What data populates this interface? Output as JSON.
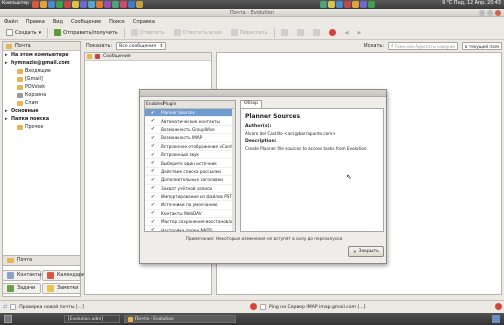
{
  "top_panel": {
    "launcher": "Компьютер",
    "clock": "9 °C   Пнд, 12 Апр, 20:43"
  },
  "window": {
    "title": "Почта - Evolution"
  },
  "menubar": [
    "Файл",
    "Правка",
    "Вид",
    "Сообщение",
    "Поиск",
    "Справка"
  ],
  "toolbar": {
    "new_label": "Создать",
    "send_receive_label": "Отправить/получить",
    "reply_label": "Ответить",
    "reply_all_label": "Ответить всем",
    "forward_label": "Переслать"
  },
  "sidebar": {
    "header": "Почта",
    "items": [
      {
        "label": "На этом компьютере",
        "indent": 0,
        "bold": true
      },
      {
        "label": "hymnazio@gmail.com",
        "indent": 0,
        "bold": true
      },
      {
        "label": "Входящие",
        "indent": 1,
        "bold": false
      },
      {
        "label": "[Gmail]",
        "indent": 1,
        "bold": false
      },
      {
        "label": "POVstek",
        "indent": 1,
        "bold": false
      },
      {
        "label": "Корзина",
        "indent": 1,
        "bold": false
      },
      {
        "label": "Спам",
        "indent": 1,
        "bold": false
      },
      {
        "label": "Основные",
        "indent": 0,
        "bold": true
      },
      {
        "label": "Папки поиска",
        "indent": 0,
        "bold": true
      },
      {
        "label": "Прочее",
        "indent": 1,
        "bold": false
      }
    ],
    "switcher": {
      "mail": "Почта",
      "contacts": "Контакты",
      "calendar": "Календари",
      "tasks": "Задачи",
      "memos": "Заметки"
    }
  },
  "filterbar": {
    "show_label": "Показать:",
    "show_value": "Все сообщения",
    "search_label": "Искать:",
    "search_placeholder": "Тема или Адресаты содержат",
    "scope_value": "в текущей папке"
  },
  "message_list": {
    "column_header": "Сообщения"
  },
  "dialog": {
    "columns": {
      "enabled": "Enabled",
      "plugin": "Plugin"
    },
    "tab": "Обзор",
    "plugins": [
      {
        "name": "Planner Sources",
        "selected": true
      },
      {
        "name": "Автоматические контакты",
        "selected": false
      },
      {
        "name": "Возможность GroupWise",
        "selected": false
      },
      {
        "name": "Возможность IMAP",
        "selected": false
      },
      {
        "name": "Встроенное отображение vCard",
        "selected": false
      },
      {
        "name": "Встроенный звук",
        "selected": false
      },
      {
        "name": "Выберите один источник",
        "selected": false
      },
      {
        "name": "Действие списка рассылки",
        "selected": false
      },
      {
        "name": "Дополнительные заголовки",
        "selected": false
      },
      {
        "name": "Захват учётной записи",
        "selected": false
      },
      {
        "name": "Импортирование из файлов PST",
        "selected": false
      },
      {
        "name": "Источники по умолчанию",
        "selected": false
      },
      {
        "name": "Контакты WebDAV",
        "selected": false
      },
      {
        "name": "Мастер сохранения-восстановления",
        "selected": false
      },
      {
        "name": "Настройка папки NNTP",
        "selected": false
      }
    ],
    "detail": {
      "title": "Planner Sources",
      "authors_label": "Author(s):",
      "authors_value": "Alvaro del Castillo <acs@barrapunto.com>",
      "description_label": "Description:",
      "description_value": "Create Planner file sources to access tasks from Evolution"
    },
    "note": "Примечание: Некоторые изменения не вступят в силу до перезапуска",
    "close_label": "Закрыть"
  },
  "statusbar": {
    "left": "Проверка новой почты [...]",
    "right": "Ping на Сервер IMAP imap.gmail.com [...]"
  },
  "taskbar": {
    "task1": "[Evolution.odm]",
    "task2": "Почта - Evolution"
  },
  "colors": {
    "selection": "#6f9bd1",
    "close_button": "#d0644a",
    "folder": "#e6b450"
  }
}
